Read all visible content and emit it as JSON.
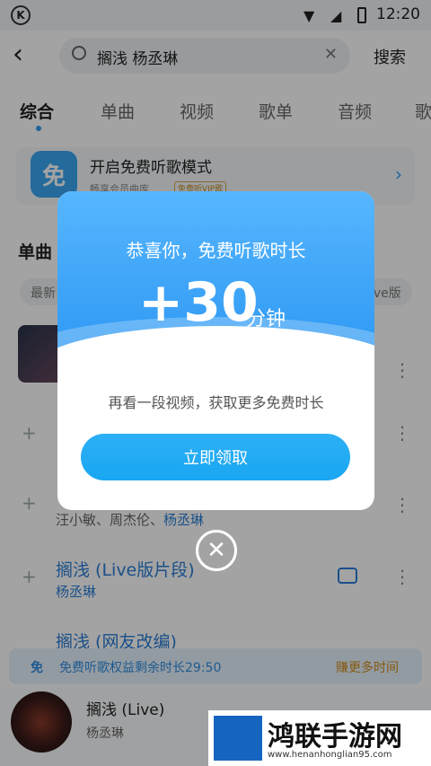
{
  "status_bar": {
    "time": "12:20"
  },
  "header": {
    "search_value": "搁浅 杨丞琳",
    "search_button": "搜索"
  },
  "tabs": [
    "综合",
    "单曲",
    "视频",
    "歌单",
    "音频",
    "歌"
  ],
  "promo": {
    "icon_char": "免",
    "title": "开启免费听歌模式",
    "subtitle": "畅享会员曲库",
    "badge": "免费听VIP歌"
  },
  "section_title": "单曲",
  "chips": [
    "最新",
    "ive版"
  ],
  "songs": [
    {
      "title": "",
      "artist": ""
    },
    {
      "title": "",
      "artist": "汪小敏、周杰伦、",
      "artist_hl": "杨丞琳"
    },
    {
      "title": "搁浅 (Live版片段)",
      "artist": "杨丞琳"
    },
    {
      "title": "搁浅 (网友改编)",
      "artist": ""
    }
  ],
  "banner": {
    "icon_char": "免",
    "text": "免费听歌权益剩余时长29:50",
    "more": "赚更多时间"
  },
  "player": {
    "title": "搁浅 (Live)",
    "artist": "杨丞琳"
  },
  "dialog": {
    "title": "恭喜你，免费听歌时长",
    "amount": "+30",
    "unit": "分钟",
    "subtitle": "再看一段视频，获取更多免费时长",
    "button": "立即领取"
  },
  "watermark": {
    "title": "鸿联手游网",
    "url": "www.henanhonglian95.com"
  },
  "colors": {
    "accent": "#2f9bf0",
    "button": "#1aa6f2",
    "banner_more": "#d08a16"
  }
}
